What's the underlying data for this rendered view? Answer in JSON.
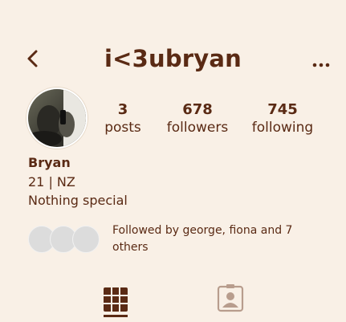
{
  "header": {
    "username": "i<3ubryan",
    "back_icon": "chevron-left-icon",
    "more_icon": "more-horizontal-icon"
  },
  "profile": {
    "avatar_icon": "profile-photo",
    "stats": [
      {
        "value": "3",
        "label": "posts"
      },
      {
        "value": "678",
        "label": "followers"
      },
      {
        "value": "745",
        "label": "following"
      }
    ],
    "name": "Bryan",
    "bio_line1": "21 | NZ",
    "bio_line2": "Nothing special",
    "followed_by": "Followed by george, fiona and 7 others"
  },
  "tabs": [
    {
      "icon": "grid-icon",
      "active": true
    },
    {
      "icon": "tagged-person-icon",
      "active": false
    }
  ],
  "colors": {
    "background": "#f9f0e6",
    "text": "#5a2a14",
    "inactive_icon": "#b89d8d",
    "placeholder_avatar": "#dcdcdc"
  }
}
